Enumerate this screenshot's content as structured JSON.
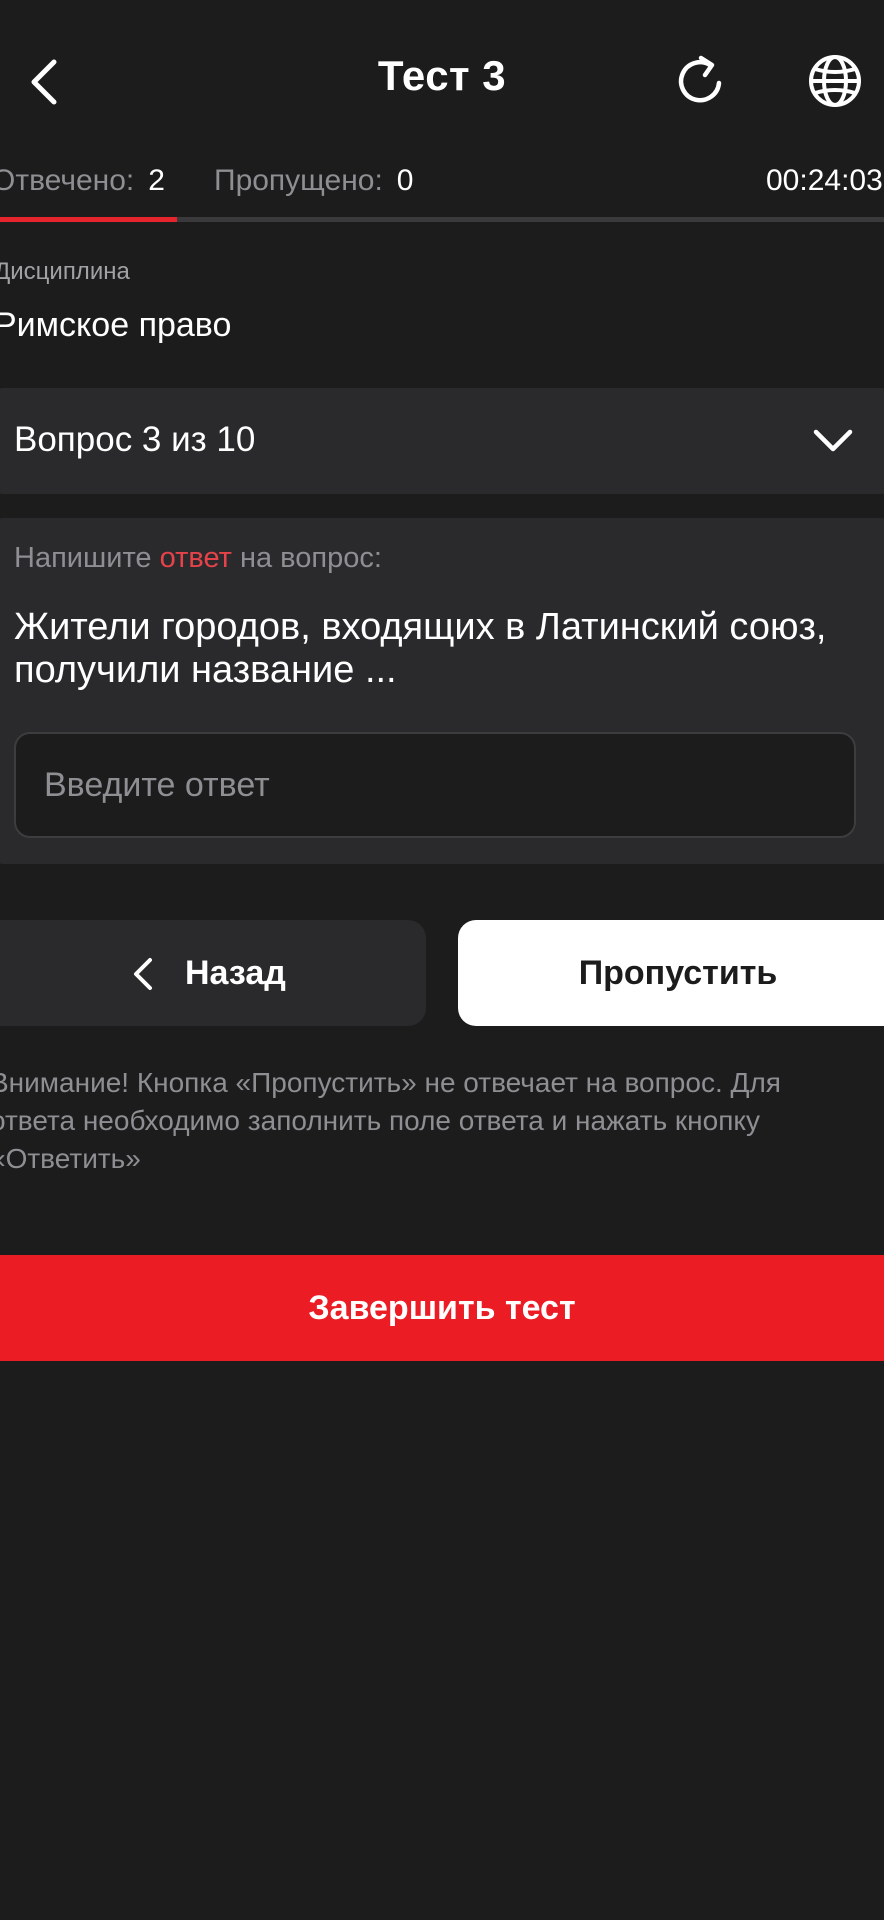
{
  "header": {
    "title": "Тест 3",
    "back_icon": "chevron-left-icon",
    "refresh_icon": "refresh-icon",
    "language_icon": "globe-icon"
  },
  "stats": {
    "answered_label": "Отвечено:",
    "answered_value": "2",
    "skipped_label": "Пропущено:",
    "skipped_value": "0",
    "timer": "00:24:03",
    "progress_fraction": 0.2
  },
  "discipline": {
    "label": "Дисциплина",
    "value": "Римское право"
  },
  "question_selector": {
    "label": "Вопрос 3 из 10",
    "icon": "chevron-down-icon"
  },
  "question": {
    "instruction_before": "Напишите ",
    "instruction_accent": "ответ",
    "instruction_after": " на вопрос:",
    "text": "Жители городов, входящих в Латинский союз, получили название ...",
    "answer_value": "",
    "answer_placeholder": "Введите ответ"
  },
  "navigation": {
    "back_label": "Назад",
    "skip_label": "Пропустить"
  },
  "warning": "Внимание! Кнопка «Пропустить» не отвечает на вопрос. Для ответа необходимо заполнить поле ответа и нажать кнопку «Ответить»",
  "finish_label": "Завершить тест",
  "colors": {
    "background": "#1c1c1d",
    "card": "#2a2a2c",
    "accent": "#ec1c24",
    "muted_text": "#8e8e93"
  }
}
